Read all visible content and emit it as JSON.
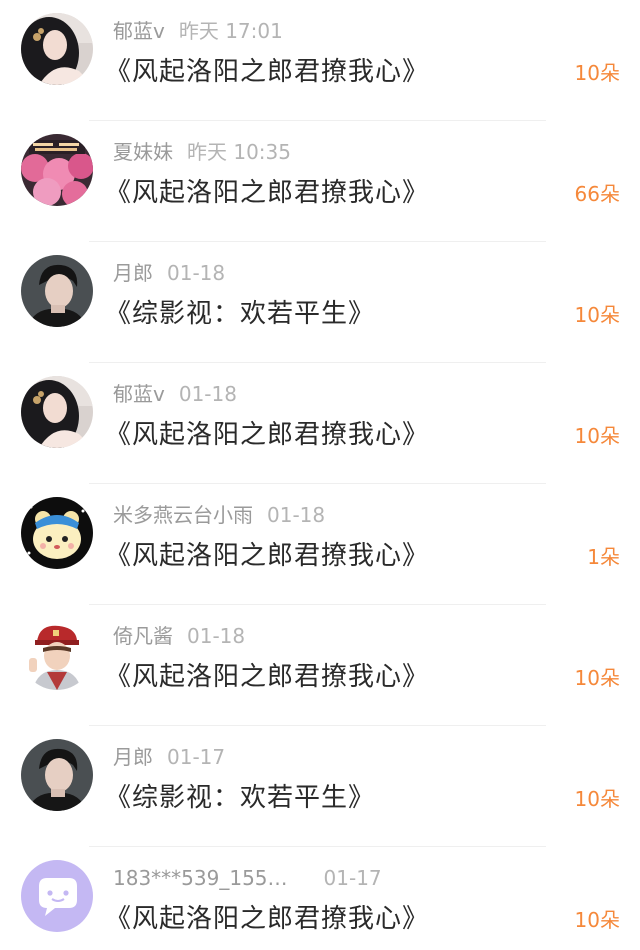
{
  "gift_list": {
    "items": [
      {
        "user": "郁蓝v",
        "time": "昨天 17:01",
        "book": "《风起洛阳之郎君撩我心》",
        "flowers": "10朵",
        "avatar": "woman-portrait-avatar"
      },
      {
        "user": "夏妹妹",
        "time": "昨天 10:35",
        "book": "《风起洛阳之郎君撩我心》",
        "flowers": "66朵",
        "avatar": "pink-blossom-avatar"
      },
      {
        "user": "月郎",
        "time": "01-18",
        "book": "《综影视：欢若平生》",
        "flowers": "10朵",
        "avatar": "man-portrait-avatar"
      },
      {
        "user": "郁蓝v",
        "time": "01-18",
        "book": "《风起洛阳之郎君撩我心》",
        "flowers": "10朵",
        "avatar": "woman-portrait-avatar"
      },
      {
        "user": "米多燕云台小雨",
        "time": "01-18",
        "book": "《风起洛阳之郎君撩我心》",
        "flowers": "1朵",
        "avatar": "cartoon-bear-avatar"
      },
      {
        "user": "倚凡酱",
        "time": "01-18",
        "book": "《风起洛阳之郎君撩我心》",
        "flowers": "10朵",
        "avatar": "red-cap-boy-avatar"
      },
      {
        "user": "月郎",
        "time": "01-17",
        "book": "《综影视：欢若平生》",
        "flowers": "10朵",
        "avatar": "man-portrait-avatar"
      },
      {
        "user": "183***539_155…",
        "time": "01-17",
        "book": "《风起洛阳之郎君撩我心》",
        "flowers": "10朵",
        "avatar": "default-chat-bubble-avatar"
      }
    ]
  },
  "colors": {
    "accent_orange": "#f5883a",
    "username_gray": "#9a9a9a",
    "title_text": "#2a2a2a",
    "default_avatar_bg": "#c4b8f3"
  }
}
